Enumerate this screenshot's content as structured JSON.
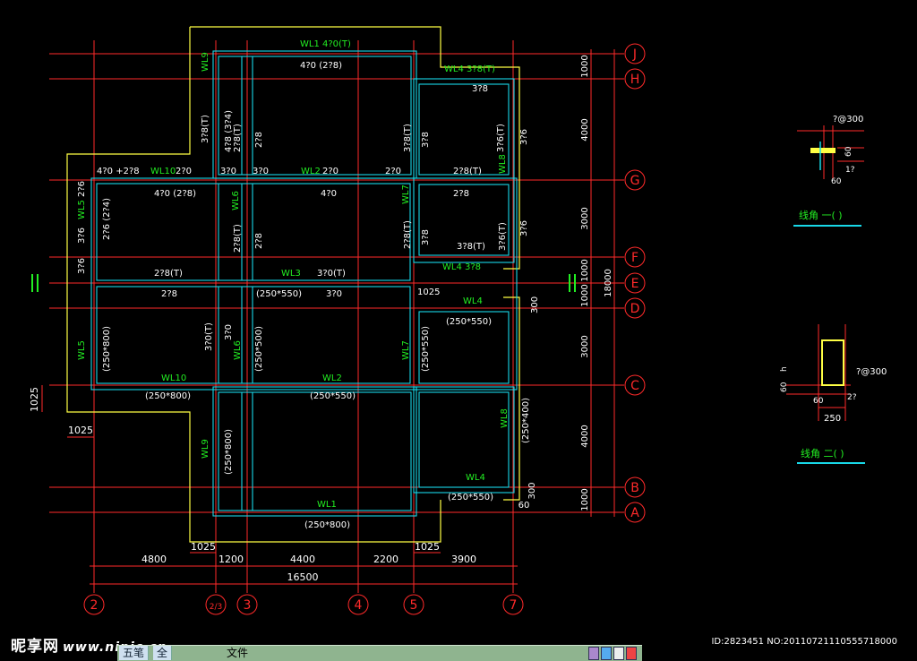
{
  "colors": {
    "axis": "#ff2a2a",
    "beam": "#ffff44",
    "slab": "#18d8e8",
    "labelGreen": "#22ee22",
    "text": "#ffffff",
    "bg": "#000000"
  },
  "axes": {
    "vertical": [
      "2",
      "3",
      "4",
      "5",
      "7"
    ],
    "vertical_sub": "2/3",
    "horizontal": [
      "J",
      "H",
      "G",
      "F",
      "E",
      "D",
      "C",
      "B",
      "A"
    ]
  },
  "dims": {
    "bottom_spans": [
      "4800",
      "1200",
      "4400",
      "2200",
      "3900"
    ],
    "bottom_total": "16500",
    "offset_1025_left": "1025",
    "offset_1025_mid": "1025",
    "offset_1025_side": "1025",
    "right_spans": [
      "1000",
      "4000",
      "3000",
      "1000",
      "1000",
      "1000",
      "3000",
      "4000",
      "1000"
    ],
    "right_total": "18000",
    "bottom_small": [
      "300",
      "60"
    ]
  },
  "beams": {
    "wl1_top": "WL1 4?0(T)",
    "wl1_top_mid": "4?0  (2?8)",
    "wl4_top": "WL4  3?8(T)",
    "h_3_8": "3?8",
    "wl9_top": "WL9",
    "r_3_8_t_1": "3?8(T)",
    "r_4_8": "4?8  (3?4)",
    "r_2_8_t": "2?8(T)",
    "r_2_8": "2?8",
    "r_3_8_t_2": "3?8(T)",
    "r_3_8_2": "3?8",
    "r_3_6_t": "3?6(T)",
    "r_3_6": "3?6",
    "g_line1": "4?0  +2?8",
    "wl10_top": "WL10",
    "g_2_70": "2?0",
    "g_3_70a": "3?0",
    "g_3_70b": "3?0",
    "wl2_top": "WL2",
    "g_2_70b": "2?0",
    "g_2_70c": "2?0",
    "g_2_8t": "2?8(T)",
    "wl8_a": "WL8",
    "wl5_top": "WL5",
    "s_2_6": "2?6",
    "s_4_70_2_8": "4?0  (2?8)",
    "s_4_70": "4?0",
    "s_2_8": "2?8",
    "wl6_a": "WL6",
    "wl7_a": "WL7",
    "s_2_74": "2?6  (2?4)",
    "s_3_6": "3?6",
    "s_2_8_t_v": "2?8(T)",
    "s_2_8_v": "2?8",
    "s_2_8_t_v2": "2?8(T)",
    "s_3_8_v": "3?8",
    "s_3_8t_h": "3?8(T)",
    "s_3_6t_v": "3?6(T)",
    "s_3_6_v2": "3?6",
    "wl4_f": "WL4  3?8",
    "e_3_6": "3?6",
    "e_2_8t": "2?8(T)",
    "wl3": "WL3",
    "e_3_70t": "3?0(T)",
    "e_2_8": "2?8",
    "e_250_550": "(250*550)",
    "e_3_70": "3?0",
    "e_1025": "1025",
    "wl4_d": "WL4",
    "d_300": "300",
    "d_250_550": "(250*550)",
    "wl5_c": "WL5",
    "c_250_800": "(250*800)",
    "c_3_70t": "3?0(T)",
    "c_3_70": "3?0",
    "wl6_c": "WL6",
    "c_250_500": "(250*500)",
    "wl7_c": "WL7",
    "c_250_550_v": "(250*550)",
    "wl10_c": "WL10",
    "c_250_800_h": "(250*800)",
    "wl2_c": "WL2",
    "c_250_550_h": "(250*550)",
    "wl8_c": "WL8",
    "c_250_400": "(250*400)",
    "wl9_b": "WL9",
    "b_250_800": "(250*800)",
    "wl4_b": "WL4",
    "b_250_550": "(250*550)",
    "wl1_a": "WL1",
    "a_250_800": "(250*800)"
  },
  "details": {
    "d1_rebar": "?@300",
    "d1_h": "60",
    "d1_b": "60",
    "d1_bar": "1?",
    "d1_title": "线角  一(   )",
    "d2_rebar": "?@300",
    "d2_h": "60",
    "d2_h2": "h",
    "d2_b": "60",
    "d2_bar": "2?",
    "d2_w": "250",
    "d2_title": "线角  二(   )"
  },
  "footer": {
    "watermark": "昵享网",
    "watermark_url": "www.nipic.cn",
    "image_id": "ID:2823451 NO:20110721110555718000",
    "ime_tab1": "五笔",
    "ime_tab2": "全",
    "ime_file": "文件"
  }
}
